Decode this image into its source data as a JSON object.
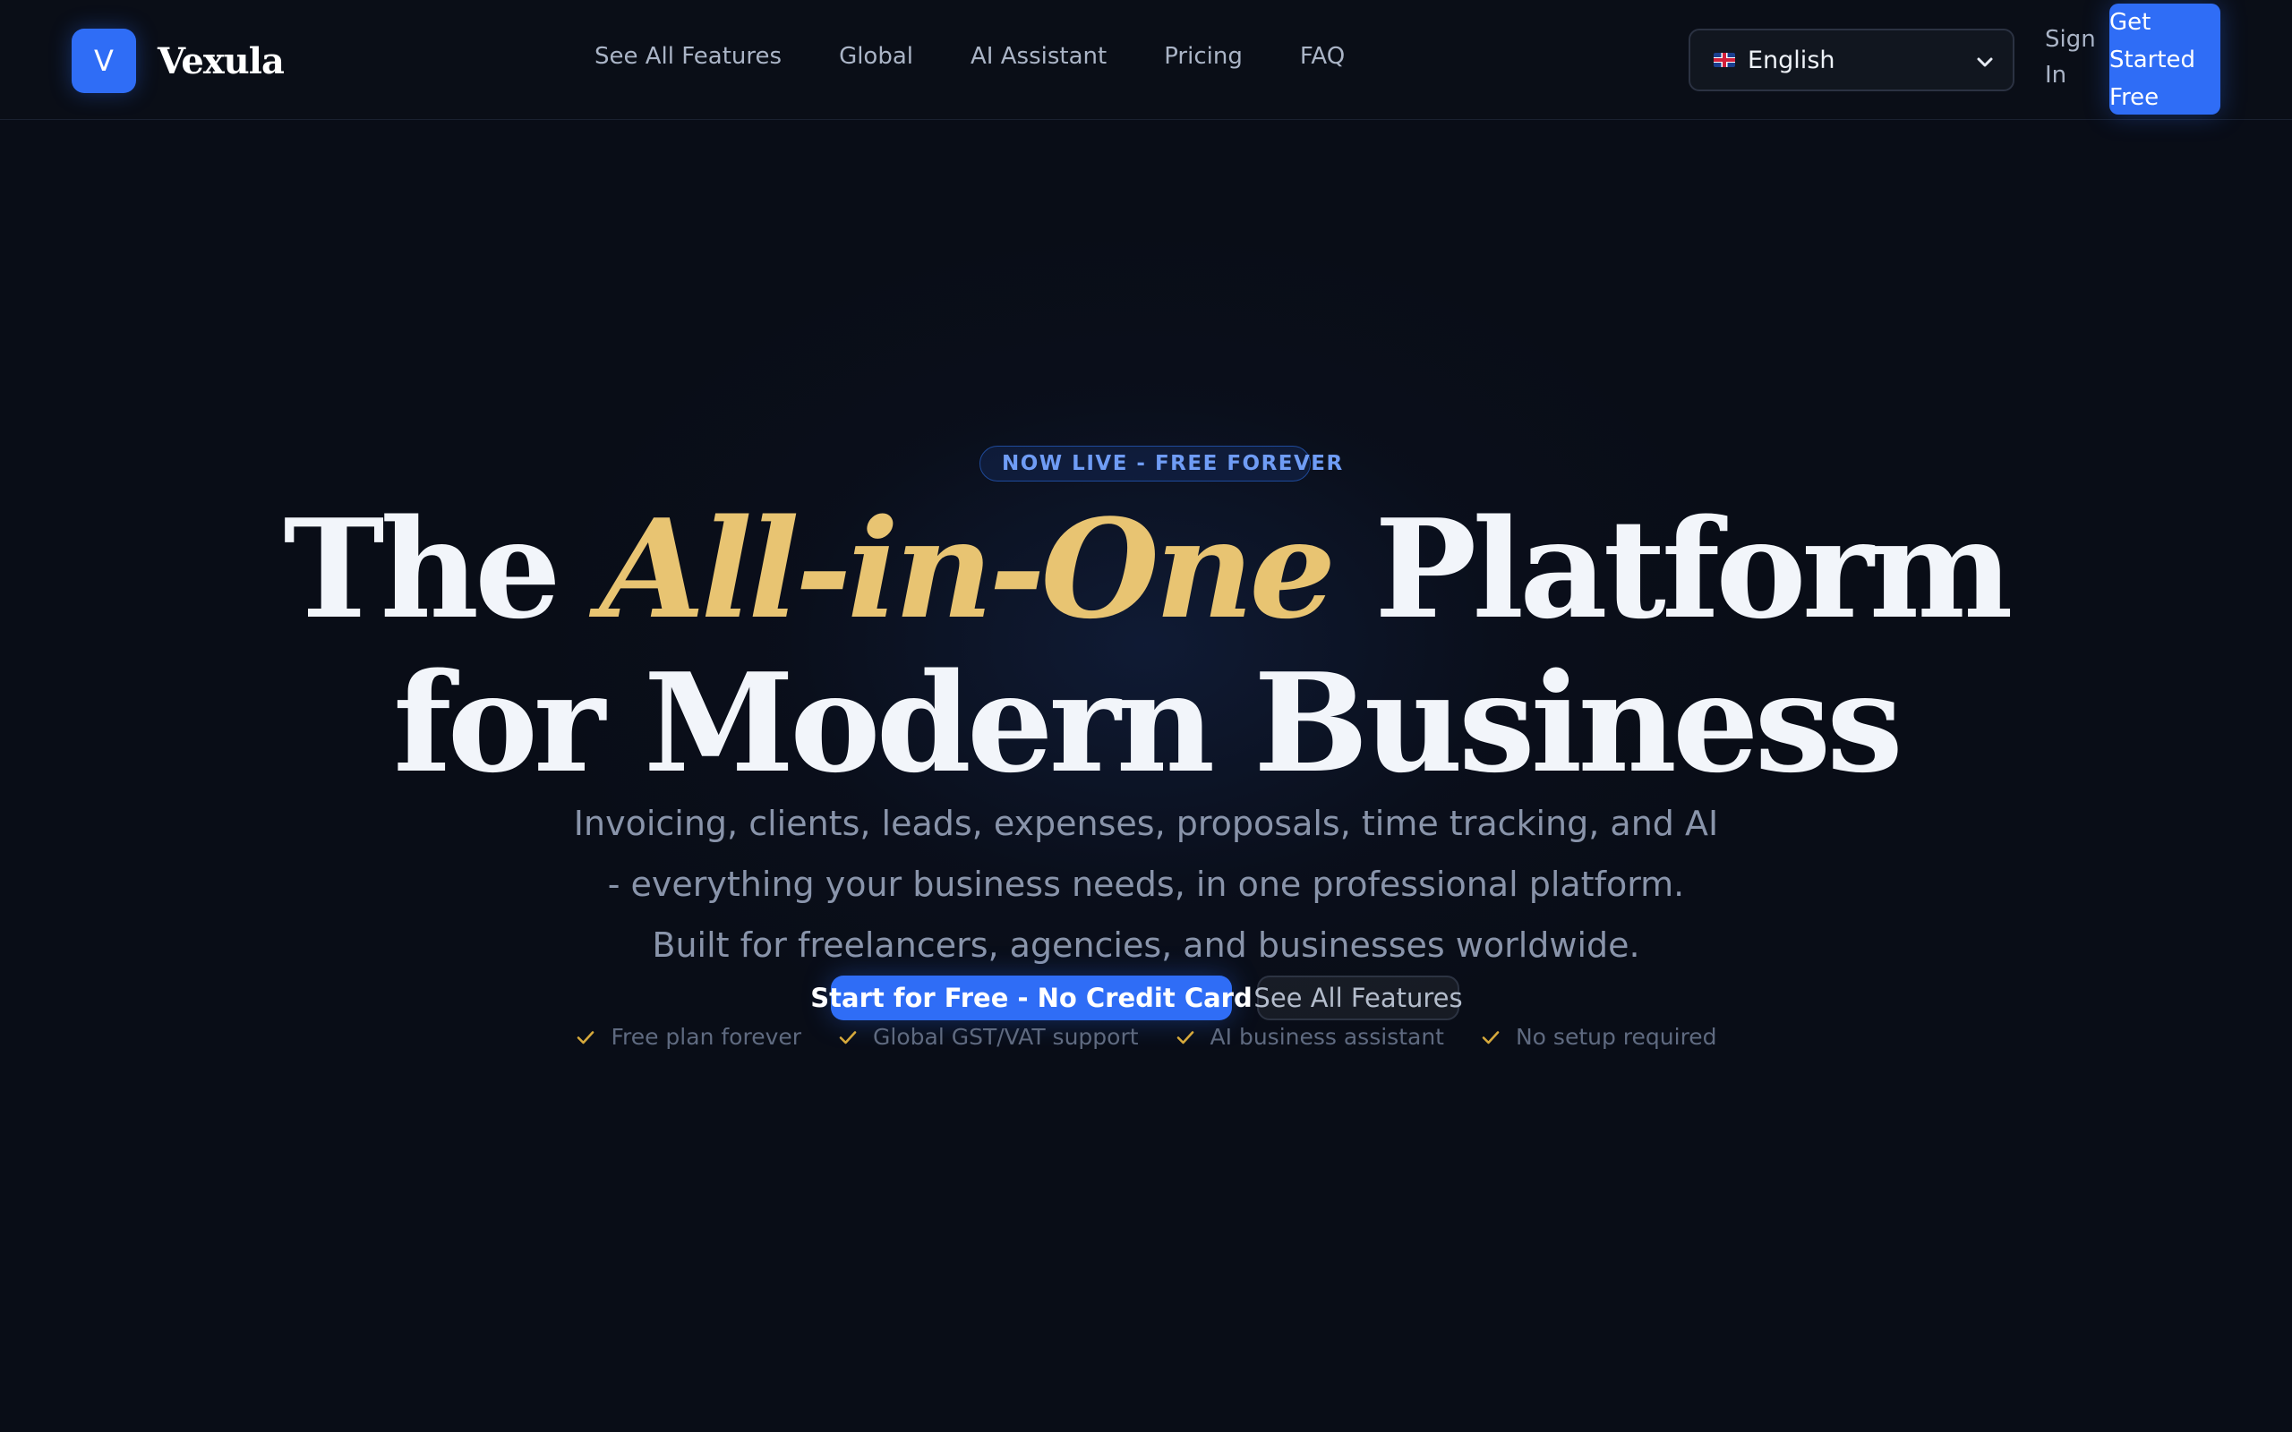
{
  "brand": {
    "logo_letter": "V",
    "name": "Vexula"
  },
  "nav": {
    "items": [
      {
        "label": "See All Features"
      },
      {
        "label": "Global"
      },
      {
        "label": "AI Assistant"
      },
      {
        "label": "Pricing"
      },
      {
        "label": "FAQ"
      }
    ]
  },
  "language": {
    "flag_icon": "uk-flag-icon",
    "selected": "English"
  },
  "header_actions": {
    "sign_in": "Sign In",
    "get_started": "Get Started Free"
  },
  "hero": {
    "badge": "NOW LIVE - FREE FOREVER",
    "headline_before": "The ",
    "headline_accent": "All-in-One",
    "headline_after_line1": " Platform",
    "headline_line2": "for Modern Business",
    "subtitle": "Invoicing, clients, leads, expenses, proposals, time tracking, and AI - everything your business needs, in one professional platform. Built for freelancers, agencies, and businesses worldwide.",
    "primary_cta": "Start for Free - No Credit Card",
    "secondary_cta": "See All Features",
    "features": [
      {
        "icon": "check-icon",
        "label": "Free plan forever"
      },
      {
        "icon": "check-icon",
        "label": "Global GST/VAT support"
      },
      {
        "icon": "check-icon",
        "label": "AI business assistant"
      },
      {
        "icon": "check-icon",
        "label": "No setup required"
      }
    ]
  },
  "colors": {
    "background": "#090d17",
    "primary": "#2f6df6",
    "accent_gold": "#e8c472",
    "check": "#d6a93c",
    "badge_text": "#6f9cf5"
  }
}
